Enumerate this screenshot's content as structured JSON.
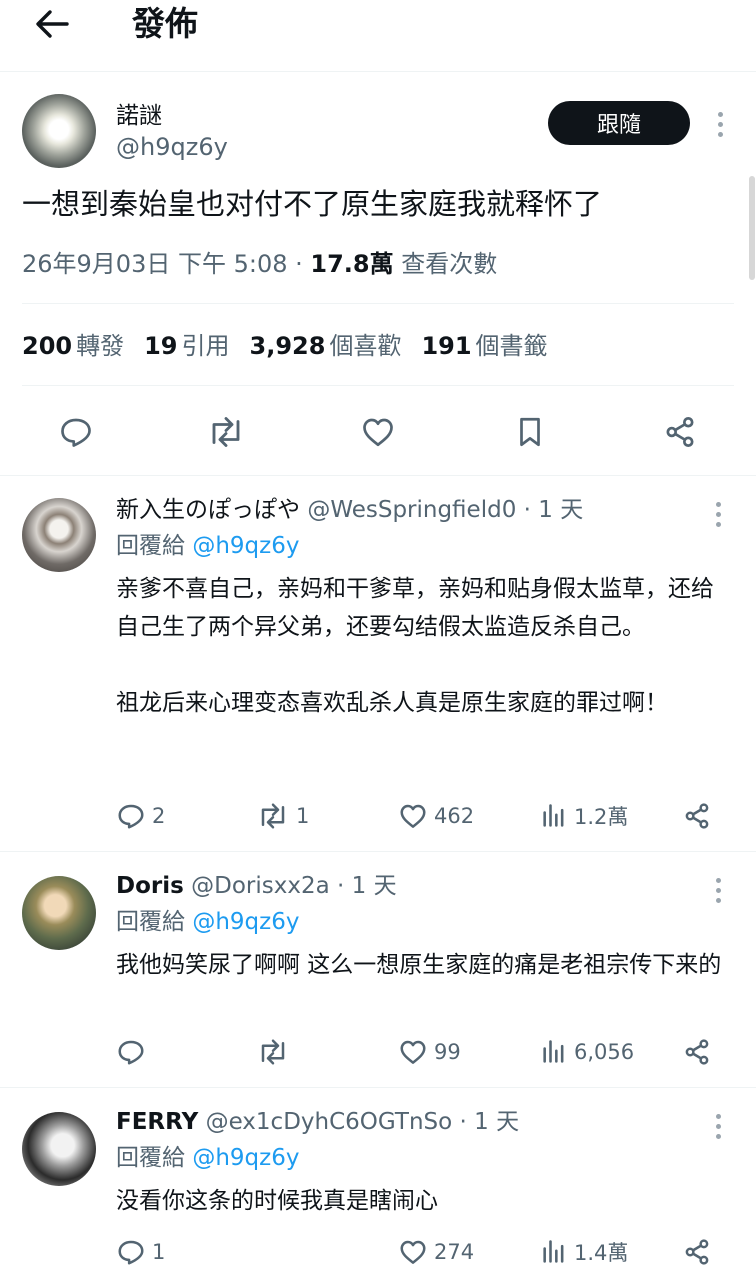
{
  "header": {
    "title": "發佈"
  },
  "post": {
    "author_name": "諾謎",
    "handle": "@h9qz6y",
    "follow_label": "跟隨",
    "text": "一想到秦始皇也对付不了原生家庭我就释怀了",
    "timestamp": "26年9月03日 下午 5:08",
    "separator": " · ",
    "views_count": "17.8萬",
    "views_label": " 查看次數",
    "stats": {
      "reposts_count": "200",
      "reposts_label": "轉發",
      "quotes_count": "19",
      "quotes_label": "引用",
      "likes_count": "3,928",
      "likes_label": "個喜歡",
      "bookmarks_count": "191",
      "bookmarks_label": "個書籤"
    },
    "actions": [
      "reply-icon",
      "repost-icon",
      "like-icon",
      "bookmark-icon",
      "share-icon"
    ]
  },
  "replies": [
    {
      "name": "新入生のぽっぽや",
      "handle": "@WesSpringfield0",
      "time": "1 天",
      "reply_prefix": "回覆給 ",
      "reply_to": "@h9qz6y",
      "paragraphs": [
        "亲爹不喜自己，亲妈和干爹草，亲妈和贴身假太监草，还给自己生了两个异父弟，还要勾结假太监造反杀自己。",
        "",
        "祖龙后来心理变态喜欢乱杀人真是原生家庭的罪过啊！"
      ],
      "replies": "2",
      "reposts": "1",
      "likes": "462",
      "views": "1.2萬"
    },
    {
      "name": "Doris",
      "handle": "@Dorisxx2a",
      "time": "1 天",
      "reply_prefix": "回覆給 ",
      "reply_to": "@h9qz6y",
      "paragraphs": [
        "我他妈笑尿了啊啊 这么一想原生家庭的痛是老祖宗传下来的"
      ],
      "replies": "",
      "reposts": "",
      "likes": "99",
      "views": "6,056"
    },
    {
      "name": "FERRY",
      "handle": "@ex1cDyhC6OGTnSo",
      "time": "1 天",
      "reply_prefix": "回覆給 ",
      "reply_to": "@h9qz6y",
      "paragraphs": [
        "没看你这条的时候我真是瞎闹心"
      ],
      "replies": "1",
      "reposts": "",
      "likes": "274",
      "views": "1.4萬"
    }
  ],
  "colors": {
    "text": "#0f1419",
    "secondary": "#536471",
    "link": "#1d9bf0",
    "border": "#eff3f4",
    "follow_bg": "#0f1419"
  }
}
